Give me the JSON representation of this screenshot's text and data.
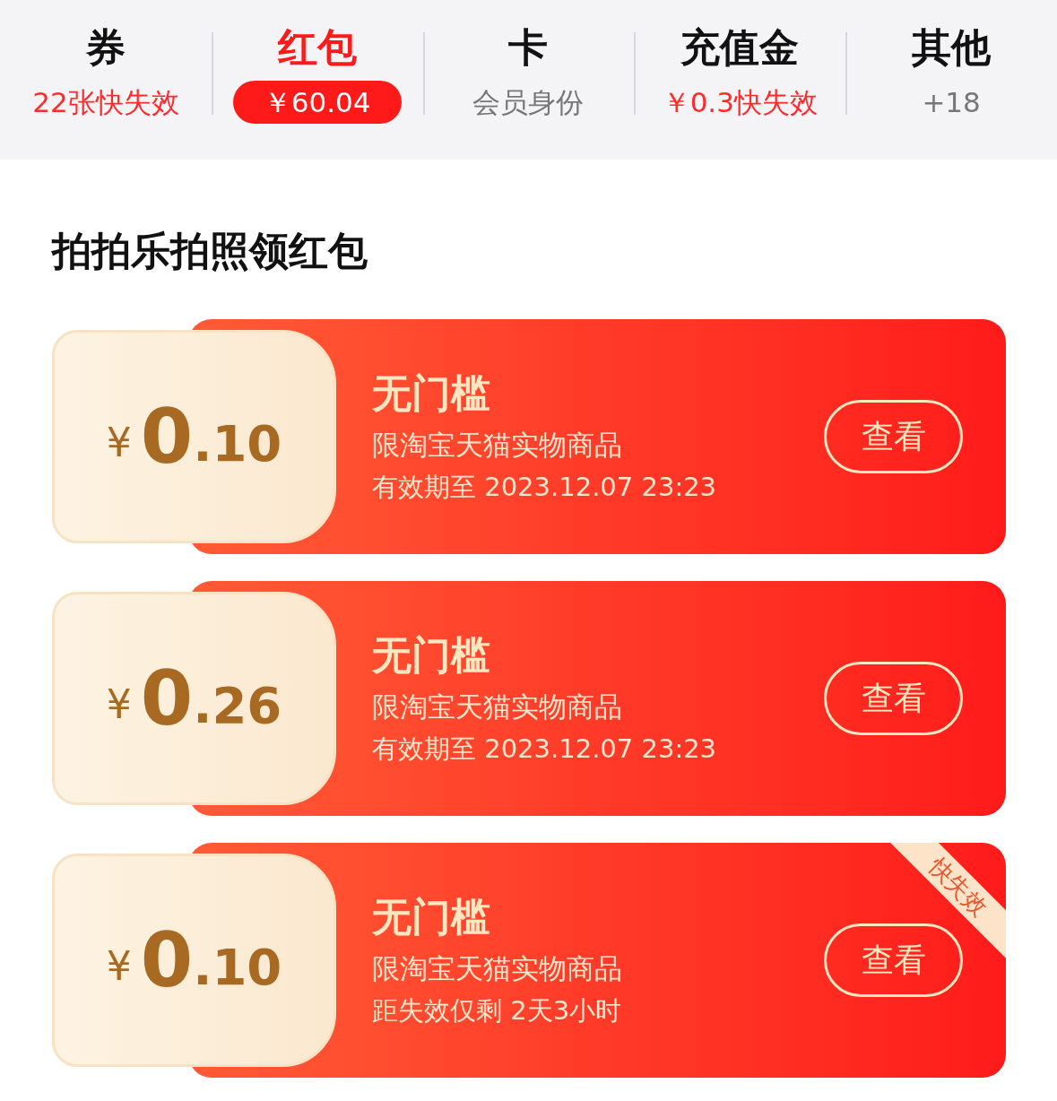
{
  "tabs": [
    {
      "title": "券",
      "subtitle": "22张快失效",
      "alert": true,
      "selected": false
    },
    {
      "title": "红包",
      "subtitle": "￥60.04",
      "selected": true
    },
    {
      "title": "卡",
      "subtitle": "会员身份",
      "alert": false,
      "selected": false
    },
    {
      "title": "充值金",
      "subtitle": "￥0.3快失效",
      "alert": true,
      "selected": false
    },
    {
      "title": "其他",
      "subtitle": "+18",
      "alert": false,
      "selected": false
    }
  ],
  "section_title": "拍拍乐拍照领红包",
  "cards": [
    {
      "currency": "¥",
      "integer": "0",
      "decimal": ".10",
      "title": "无门槛",
      "scope": "限淘宝天猫实物商品",
      "expiry": "有效期至 2023.12.07 23:23",
      "button": "查看"
    },
    {
      "currency": "¥",
      "integer": "0",
      "decimal": ".26",
      "title": "无门槛",
      "scope": "限淘宝天猫实物商品",
      "expiry": "有效期至 2023.12.07 23:23",
      "button": "查看"
    },
    {
      "currency": "¥",
      "integer": "0",
      "decimal": ".10",
      "title": "无门槛",
      "scope": "限淘宝天猫实物商品",
      "expiry": "距失效仅剩 2天3小时",
      "button": "查看",
      "badge": "快失效"
    }
  ]
}
